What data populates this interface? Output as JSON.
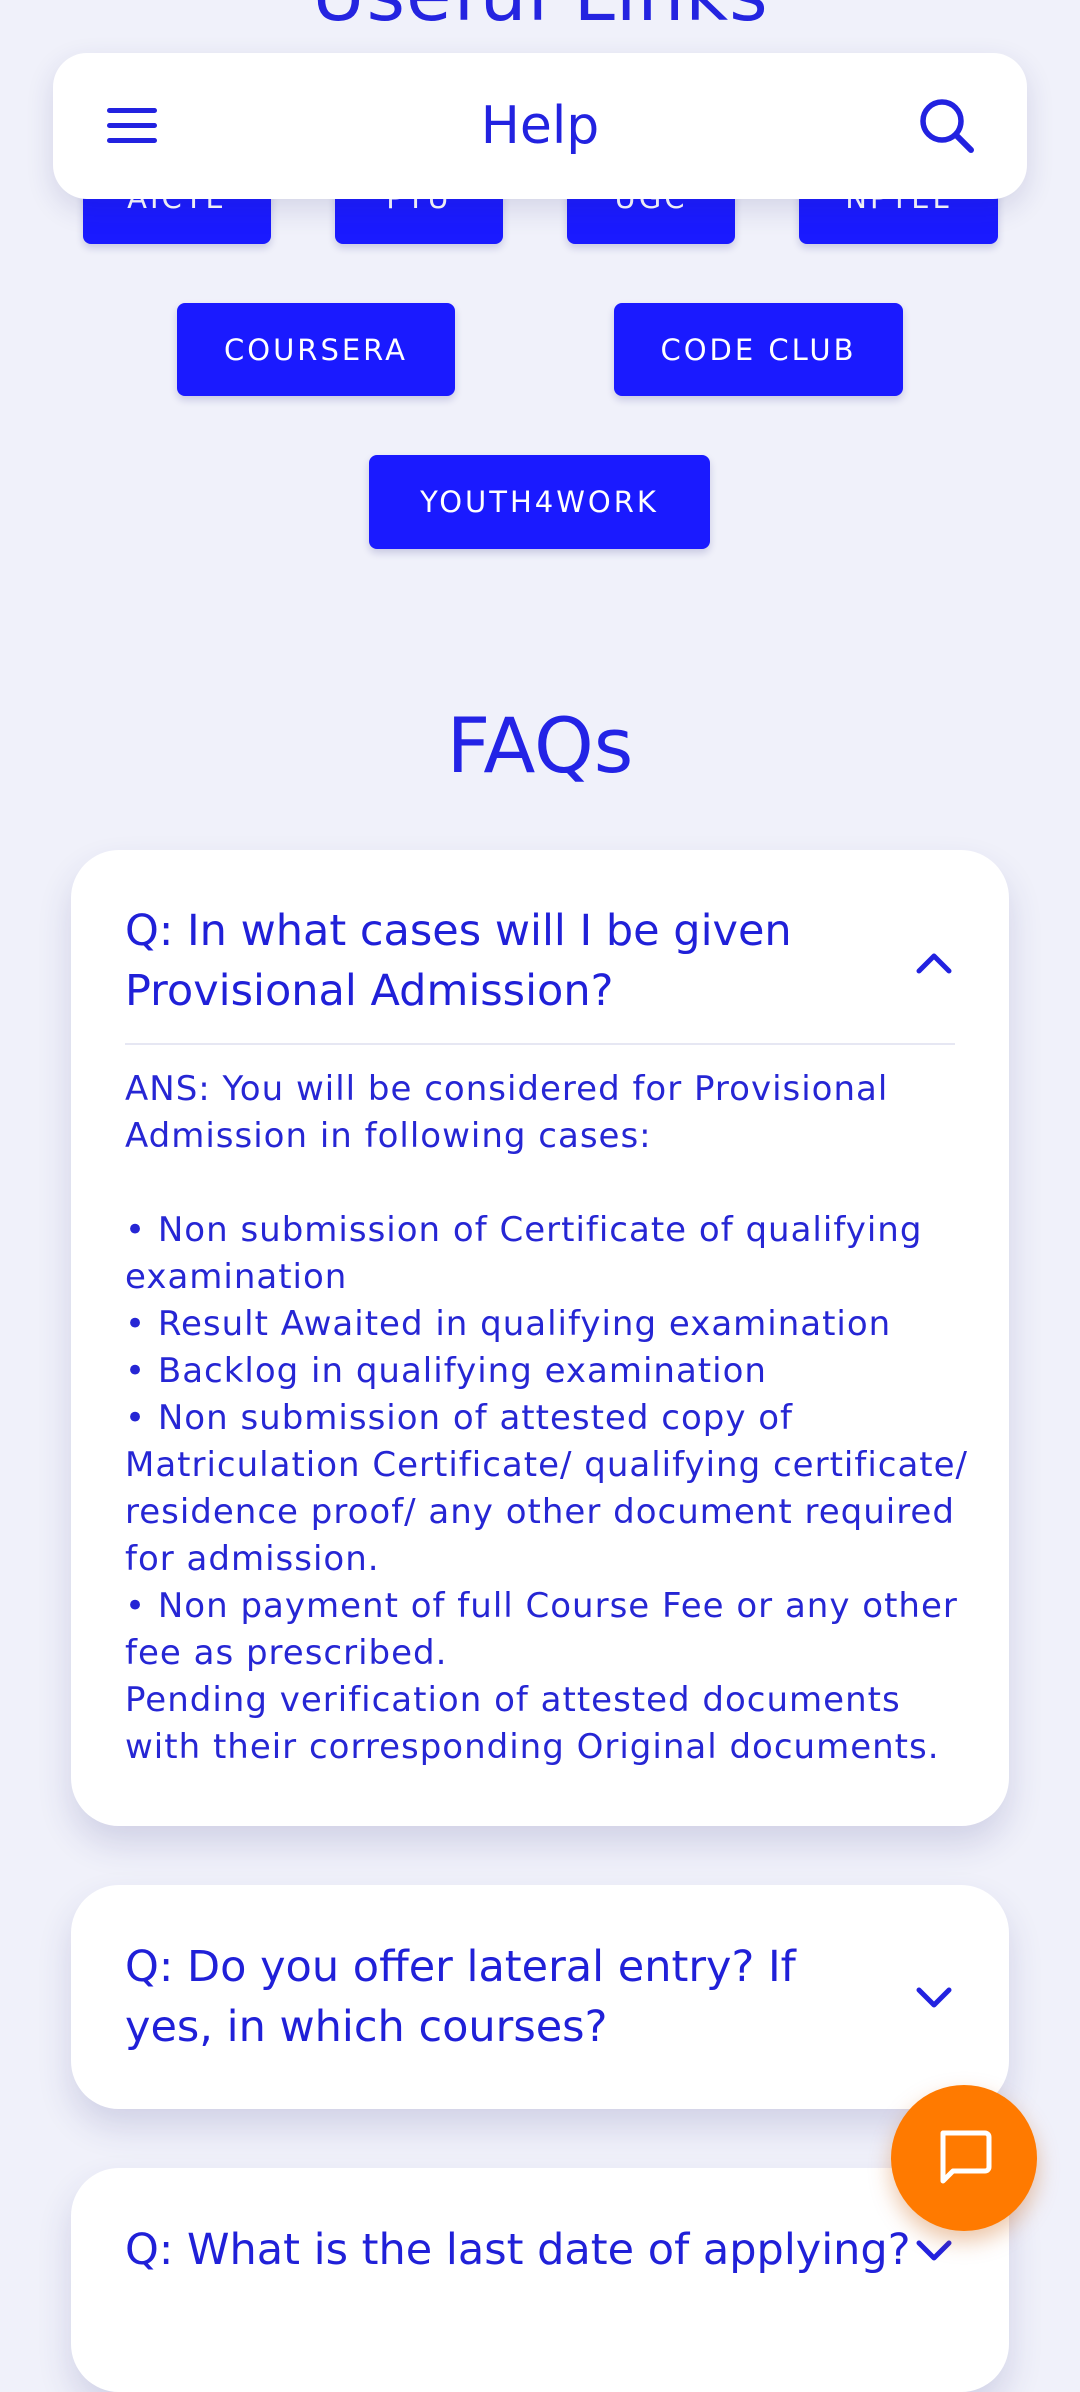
{
  "app_bar": {
    "title": "Help",
    "menu_icon": "hamburger-menu-icon",
    "search_icon": "search-icon"
  },
  "useful_links": {
    "title": "Useful Links",
    "row1": [
      "AICTE",
      "PTU",
      "UGC",
      "NPTEL"
    ],
    "row2": [
      "COURSERA",
      "CODE CLUB"
    ],
    "row3": [
      "YOUTH4WORK"
    ]
  },
  "faqs": {
    "title": "FAQs",
    "items": [
      {
        "question": "Q: In what cases will I be given Provisional Admission?",
        "expanded": true,
        "answer_intro": "ANS: You will be considered for Provisional Admission in following cases:",
        "answer_lines": [
          "• Non submission of Certificate of qualifying examination",
          "• Result Awaited in qualifying examination",
          "• Backlog in qualifying examination",
          "• Non submission of attested copy of Matriculation Certificate/ qualifying certificate/ residence proof/ any other document required for admission.",
          "• Non payment of full Course Fee or any other fee as prescribed.",
          "Pending verification of attested documents with their corresponding Original documents."
        ]
      },
      {
        "question": "Q: Do you offer lateral entry? If yes, in which courses?",
        "expanded": false
      },
      {
        "question": "Q: What is the last date of applying?",
        "expanded": false
      }
    ]
  },
  "fab": {
    "icon": "chat-icon"
  },
  "colors": {
    "background": "#f0f1fa",
    "primary": "#1a1aff",
    "text": "#2323e6",
    "fab": "#ff7a00"
  }
}
